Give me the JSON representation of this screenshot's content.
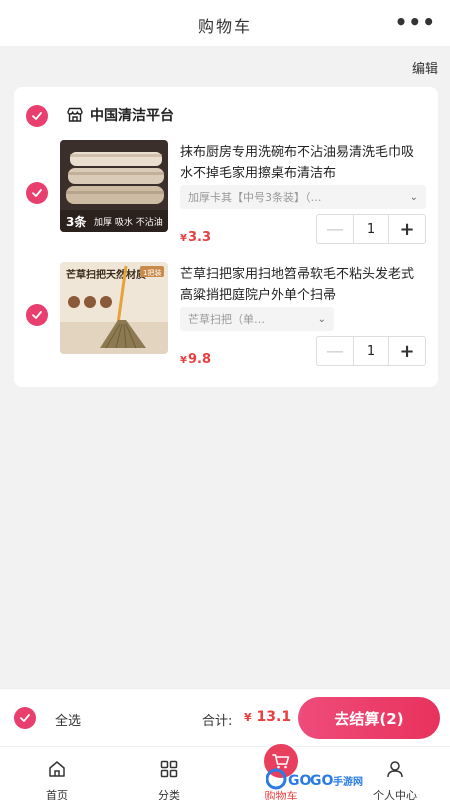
{
  "header": {
    "title": "购物车",
    "more_icon": "more-dots-icon"
  },
  "edit_label": "编辑",
  "shop": {
    "name": "中国清洁平台",
    "icon": "shop-icon",
    "checked": true
  },
  "items": [
    {
      "name": "抹布厨房专用洗碗布不沾油易清洗毛巾吸水不掉毛家用擦桌布清洁布",
      "spec": "加厚卡其【中号3条装】（…",
      "price_symbol": "¥",
      "price": "3.3",
      "quantity": "1",
      "checked": true,
      "thumb_badge_text": "3条",
      "thumb_caption": "加厚 吸水 不沾油"
    },
    {
      "name": "芒草扫把家用扫地笤帚软毛不粘头发老式高粱捎把庭院户外单个扫帚",
      "spec": "芒草扫把（单…",
      "price_symbol": "¥",
      "price": "9.8",
      "quantity": "1",
      "checked": true,
      "thumb_title": "芒草扫把天然材质",
      "thumb_tag": "1把装"
    }
  ],
  "checkout": {
    "select_all_label": "全选",
    "total_label": "合计:",
    "total_symbol": "¥",
    "total_value": "13.1",
    "checkout_label": "去结算(2)"
  },
  "tabbar": {
    "home": "首页",
    "category": "分类",
    "cart": "购物车",
    "profile": "个人中心"
  },
  "watermark": {
    "text_1": "GO",
    "text_2": "GO",
    "text_3": "手游网",
    "color": "#2a7be4"
  },
  "colors": {
    "accent": "#e83f6f",
    "price": "#e83f3f"
  }
}
